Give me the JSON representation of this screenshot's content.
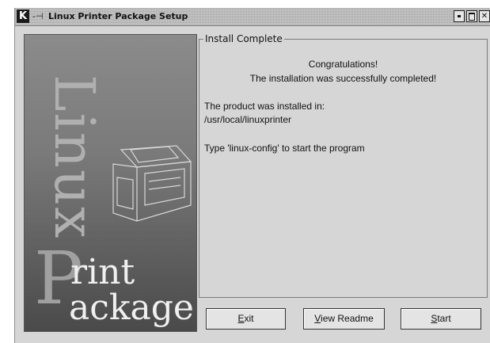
{
  "window": {
    "title": "Linux Printer Package Setup",
    "logo": "K",
    "pin_glyph": "-⊣"
  },
  "banner": {
    "linux_word": "Linux",
    "print_letter": "P",
    "print_rest": "rint",
    "package_rest": "ackage"
  },
  "group": {
    "legend": "Install Complete",
    "congrats": "Congratulations!",
    "success": "The installation was successfully completed!",
    "installed_in_label": "The product was installed in:",
    "install_path": "/usr/local/linuxprinter",
    "hint": "Type 'linux-config' to start the program"
  },
  "buttons": {
    "exit": {
      "mnemonic": "E",
      "rest": "xit"
    },
    "readme": {
      "mnemonic": "V",
      "rest": "iew Readme"
    },
    "start": {
      "mnemonic": "S",
      "rest": "tart"
    }
  }
}
